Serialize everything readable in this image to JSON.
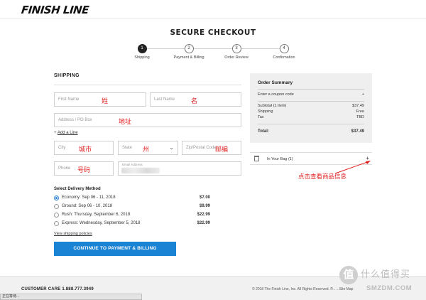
{
  "brand": {
    "logo_text": "FINISH LINE"
  },
  "page_title": "SECURE CHECKOUT",
  "steps": [
    {
      "num": "1",
      "label": "Shipping",
      "active": true
    },
    {
      "num": "2",
      "label": "Payment & Billing",
      "active": false
    },
    {
      "num": "3",
      "label": "Order Review",
      "active": false
    },
    {
      "num": "4",
      "label": "Confirmation",
      "active": false
    }
  ],
  "shipping": {
    "title": "SHIPPING",
    "first_name": {
      "placeholder": "First Name",
      "annotation": "姓"
    },
    "last_name": {
      "placeholder": "Last Name",
      "annotation": "名"
    },
    "address": {
      "placeholder": "Address / PO Box",
      "annotation": "地址"
    },
    "add_line": {
      "icon": "+",
      "label": "Add a Line"
    },
    "city": {
      "placeholder": "City",
      "annotation": "城市"
    },
    "state": {
      "placeholder": "State",
      "annotation": "州"
    },
    "zip": {
      "placeholder": "Zip/Postal Code",
      "annotation": "邮编"
    },
    "phone": {
      "placeholder": "Phone",
      "annotation": "号码"
    },
    "email": {
      "label": "Email Address"
    }
  },
  "delivery": {
    "title": "Select Delivery Method",
    "options": [
      {
        "label": "Economy: Sep 06 - 11, 2018",
        "price": "$7.00",
        "selected": true
      },
      {
        "label": "Ground: Sep 06 - 10, 2018",
        "price": "$9.99",
        "selected": false
      },
      {
        "label": "Rush: Thursday, September 6, 2018",
        "price": "$22.99",
        "selected": false
      },
      {
        "label": "Express: Wednesday, September 5, 2018",
        "price": "$22.99",
        "selected": false
      }
    ],
    "policies_link": "View shipping policies"
  },
  "cta_label": "CONTINUE TO PAYMENT & BILLING",
  "summary": {
    "title": "Order Summary",
    "coupon_label": "Enter a coupon code",
    "coupon_icon": "+",
    "subtotal_label": "Subtotal (1 item)",
    "subtotal_value": "$37.49",
    "shipping_label": "Shipping",
    "shipping_value": "Free",
    "tax_label": "Tax",
    "tax_value": "TBD",
    "total_label": "Total:",
    "total_value": "$37.49"
  },
  "bag": {
    "label": "In Your Bag (1)",
    "icon": "+"
  },
  "annotation_bag": "点击查看商品信息",
  "footer": {
    "customer_care": "CUSTOMER CARE 1.888.777.3949",
    "copyright": "© 2018 The Finish Line, Inc. All Rights Reserved.  P... ...Site Map"
  },
  "status_bar": "正在等待...",
  "watermark": {
    "cn": "什么值得买",
    "en": "SMZDM.COM",
    "icon": "值"
  },
  "colors": {
    "accent": "#1b83d3",
    "annotation_red": "#e02020",
    "summary_bg": "#efefef"
  }
}
